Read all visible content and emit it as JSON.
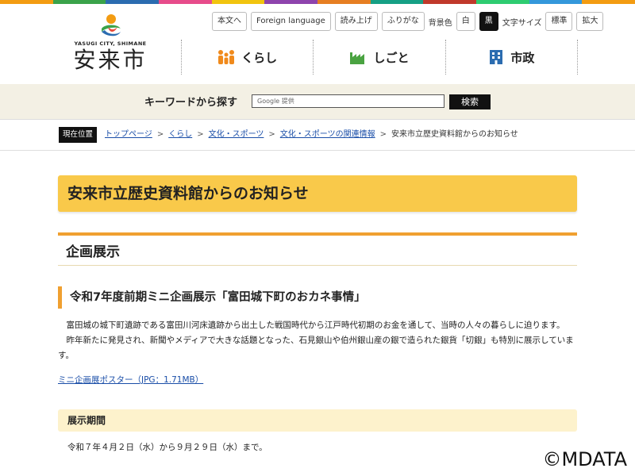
{
  "brand": {
    "logo_en": "YASUGI CITY, SHIMANE",
    "logo_ja": "安来市",
    "accent_colors": [
      "#f39c12",
      "#3aa34a",
      "#2b6cb0",
      "#e74c8b",
      "#f1c40f",
      "#8e44ad",
      "#e67e22",
      "#16a085",
      "#c0392b",
      "#2ecc71",
      "#3498db",
      "#f39c12"
    ]
  },
  "utility": {
    "main_text": "本文へ",
    "foreign_language": "Foreign language",
    "read_aloud": "読み上げ",
    "furigana": "ふりがな",
    "bg_color_label": "背景色",
    "bg_white": "白",
    "bg_black": "黒",
    "font_size_label": "文字サイズ",
    "font_standard": "標準",
    "font_large": "拡大"
  },
  "global_nav": [
    {
      "label": "くらし",
      "icon": "family-icon",
      "color": "#f08a1c"
    },
    {
      "label": "しごと",
      "icon": "factory-icon",
      "color": "#4aa341"
    },
    {
      "label": "市政",
      "icon": "building-icon",
      "color": "#2b6cb0"
    }
  ],
  "search": {
    "label": "キーワードから探す",
    "placeholder": "Google 提供",
    "button": "検索"
  },
  "breadcrumb": {
    "label": "現在位置",
    "items": [
      "トップページ",
      "くらし",
      "文化・スポーツ",
      "文化・スポーツの関連情報"
    ],
    "current": "安来市立歴史資料館からのお知らせ"
  },
  "page": {
    "title": "安来市立歴史資料館からのお知らせ",
    "section_title": "企画展示",
    "exhibit_title": "令和7年度前期ミニ企画展示「富田城下町のおカネ事情」",
    "paragraph1": "富田城の城下町遺跡である富田川河床遺跡から出土した戦国時代から江戸時代初期のお金を通して、当時の人々の暮らしに迫ります。",
    "paragraph2": "昨年新たに発見され、新聞やメディアで大きな話題となった、石見銀山や伯州銀山産の銀で造られた銀貨「切銀」も特別に展示しています。",
    "poster_link": "ミニ企画展ポスター（JPG：1.71MB）",
    "period_heading": "展示期間",
    "period_text": "令和７年４月２日（水）から９月２９日（水）まで。"
  },
  "watermark": "©MDATA"
}
